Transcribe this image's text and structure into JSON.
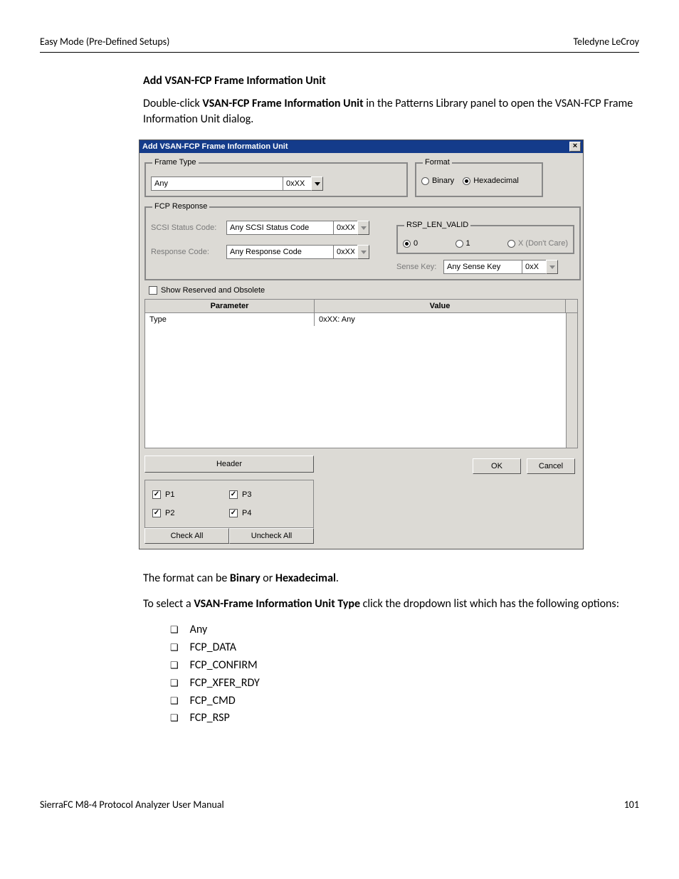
{
  "doc": {
    "header_left": "Easy Mode (Pre-Defined Setups)",
    "header_right": "Teledyne  LeCroy",
    "footer_left": "SierraFC M8-4 Protocol Analyzer User Manual",
    "footer_right": "101"
  },
  "section": {
    "title": "Add VSAN-FCP Frame Information Unit",
    "intro_pre": "Double-click ",
    "intro_bold": "VSAN-FCP Frame Information Unit",
    "intro_post": " in the Patterns Library panel to open the VSAN-FCP Frame Information Unit dialog.",
    "format_line_pre": "The format can be ",
    "format_b1": "Binary",
    "format_mid": " or ",
    "format_b2": "Hexadecimal",
    "format_post": ".",
    "select_pre": "To select a ",
    "select_bold": "VSAN-Frame Information Unit Type",
    "select_post": " click the dropdown list which has the following options:",
    "options": [
      "Any",
      "FCP_DATA",
      "FCP_CONFIRM",
      "FCP_XFER_RDY",
      "FCP_CMD",
      "FCP_RSP"
    ]
  },
  "dialog": {
    "title": "Add VSAN-FCP Frame Information Unit",
    "frame_type": {
      "legend": "Frame Type",
      "value": "Any",
      "hex": "0xXX"
    },
    "format": {
      "legend": "Format",
      "binary": "Binary",
      "hex": "Hexadecimal",
      "selected": "hex"
    },
    "fcp": {
      "legend": "FCP Response",
      "scsi_label": "SCSI Status Code:",
      "scsi_value": "Any SCSI Status Code",
      "scsi_hex": "0xXX",
      "resp_label": "Response Code:",
      "resp_value": "Any Response Code",
      "resp_hex": "0xXX",
      "rsp_legend": "RSP_LEN_VALID",
      "rsp_opt0": "0",
      "rsp_opt1": "1",
      "rsp_optx": "X (Don't Care)",
      "sense_label": "Sense Key:",
      "sense_value": "Any Sense Key",
      "sense_hex": "0xX"
    },
    "show_reserved": "Show Reserved and Obsolete",
    "grid": {
      "col_param": "Parameter",
      "col_value": "Value",
      "row_param": "Type",
      "row_value": "0xXX: Any"
    },
    "header_btn": "Header",
    "ok": "OK",
    "cancel": "Cancel",
    "ports": {
      "p1": "P1",
      "p2": "P2",
      "p3": "P3",
      "p4": "P4"
    },
    "check_all": "Check All",
    "uncheck_all": "Uncheck All"
  }
}
